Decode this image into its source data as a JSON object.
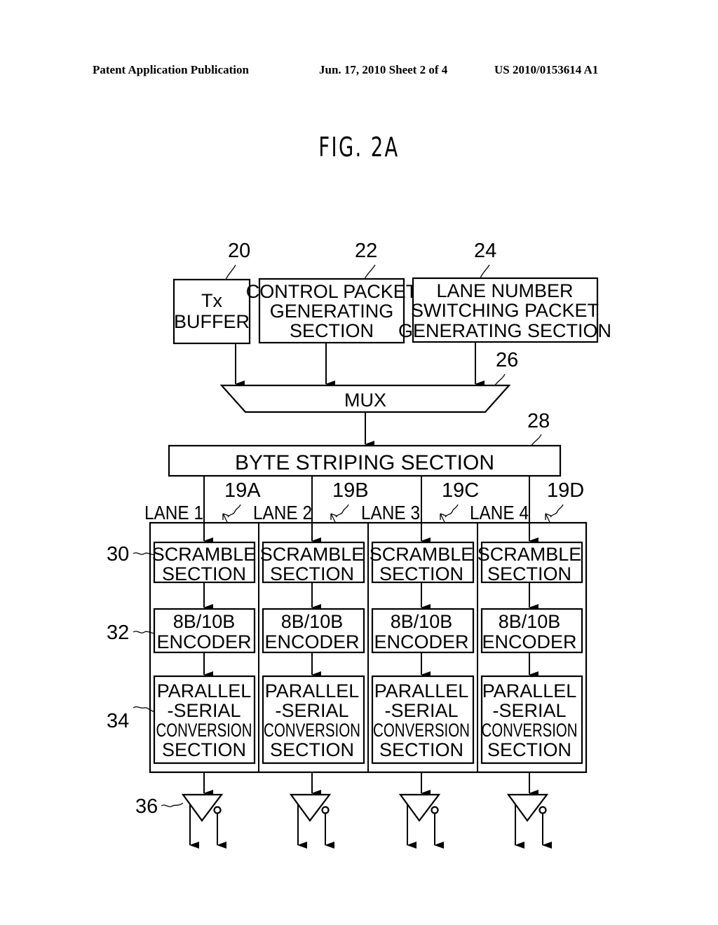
{
  "header": {
    "left": "Patent Application Publication",
    "middle": "Jun. 17, 2010  Sheet 2 of 4",
    "right": "US 2010/0153614 A1"
  },
  "figure": {
    "title": "FIG. 2A",
    "top_blocks": [
      {
        "ref": "20",
        "lines": [
          "Tx",
          "BUFFER"
        ]
      },
      {
        "ref": "22",
        "lines": [
          "CONTROL PACKET",
          "GENERATING",
          "SECTION"
        ]
      },
      {
        "ref": "24",
        "lines": [
          "LANE NUMBER",
          "SWITCHING PACKET",
          "GENERATING SECTION"
        ]
      }
    ],
    "mux": {
      "ref": "26",
      "label": "MUX"
    },
    "striping": {
      "ref": "28",
      "label": "BYTE STRIPING SECTION"
    },
    "lanes": [
      {
        "label": "LANE 1",
        "ref": "19A"
      },
      {
        "label": "LANE 2",
        "ref": "19B"
      },
      {
        "label": "LANE 3",
        "ref": "19C"
      },
      {
        "label": "LANE 4",
        "ref": "19D"
      }
    ],
    "lane_blocks": {
      "scramble": {
        "ref": "30",
        "lines": [
          "SCRAMBLE",
          "SECTION"
        ]
      },
      "encoder": {
        "ref": "32",
        "lines": [
          "8B/10B",
          "ENCODER"
        ]
      },
      "ps": {
        "ref": "34",
        "lines": [
          "PARALLEL",
          "-SERIAL",
          "CONVERSION",
          "SECTION"
        ]
      }
    },
    "driver": {
      "ref": "36"
    }
  }
}
